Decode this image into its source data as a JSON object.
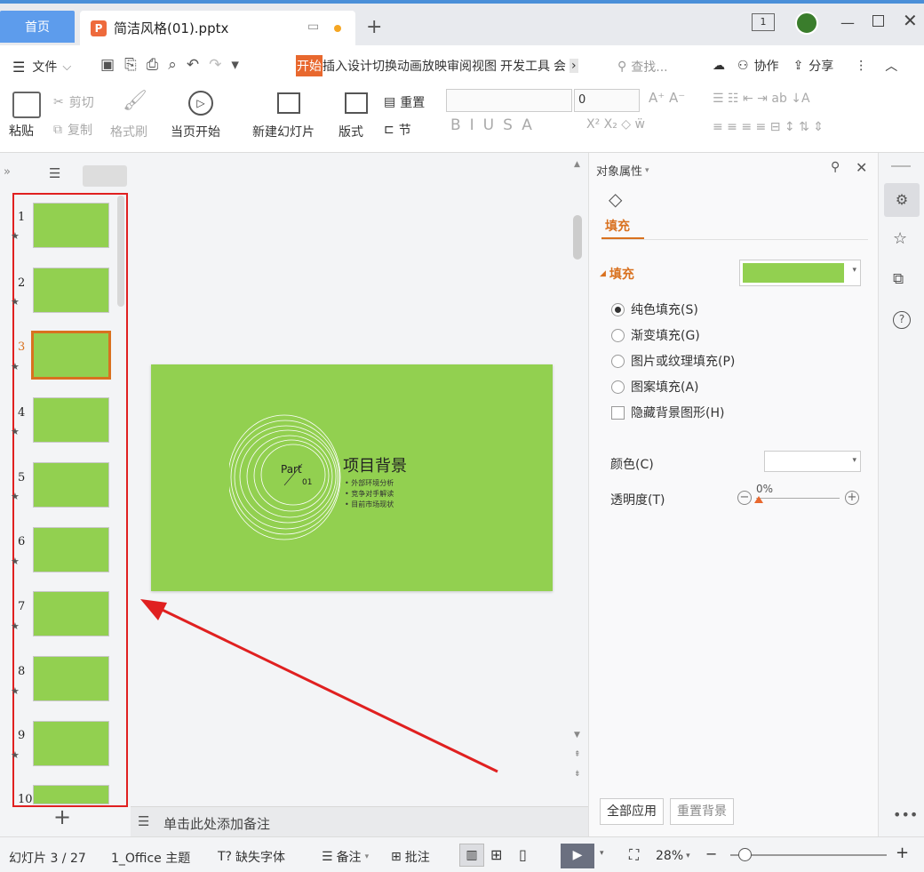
{
  "tabs": {
    "home": "首页",
    "doc": "简洁风格(01).pptx",
    "new": "+"
  },
  "menubar": {
    "file": "文件",
    "ribbon_tabs": [
      "开始",
      "插入",
      "设计",
      "切换",
      "动画",
      "放映",
      "审阅",
      "视图",
      "开发工具",
      "会"
    ],
    "search": "查找...",
    "collab": "协作",
    "share": "分享"
  },
  "ribbon": {
    "paste": "粘贴",
    "cut": "剪切",
    "copy": "复制",
    "format_painter": "格式刷",
    "play_from_current": "当页开始",
    "new_slide": "新建幻灯片",
    "layout": "版式",
    "reset": "重置",
    "section": "节",
    "font_size": "0"
  },
  "slides": {
    "count_visible": [
      "1",
      "2",
      "3",
      "4",
      "5",
      "6",
      "7",
      "8",
      "9",
      "10"
    ],
    "selected": "3",
    "add": "+"
  },
  "slide": {
    "part": "Part",
    "num": "01",
    "title": "项目背景",
    "bullets": [
      "外部环境分析",
      "竞争对手解读",
      "目前市场现状"
    ],
    "bg_color": "#92d050"
  },
  "notes": "单击此处添加备注",
  "panel": {
    "title": "对象属性",
    "tab": "填充",
    "section": "填充",
    "fill_color": "#92d050",
    "options": [
      "纯色填充(S)",
      "渐变填充(G)",
      "图片或纹理填充(P)",
      "图案填充(A)"
    ],
    "hide_bg": "隐藏背景图形(H)",
    "color_label": "颜色(C)",
    "transparency_label": "透明度(T)",
    "transparency_value": "0%",
    "apply_all": "全部应用",
    "reset_bg": "重置背景"
  },
  "status": {
    "slide_counter": "幻灯片 3 / 27",
    "theme": "1_Office 主题",
    "missing_font": "缺失字体",
    "notes": "备注",
    "comment": "批注",
    "zoom": "28%"
  },
  "colors": {
    "accent": "#d9711f",
    "home_tab": "#5d9cec",
    "annotation": "#e02020"
  }
}
